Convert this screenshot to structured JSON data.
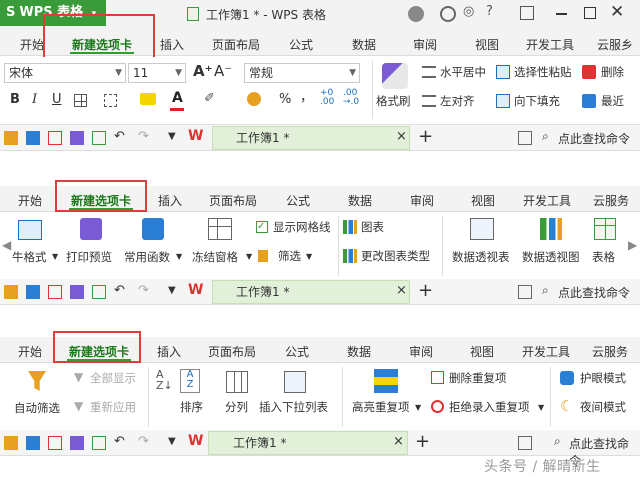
{
  "app": {
    "logo_text": "WPS 表格",
    "doc_title": "工作簿1 * - WPS 表格",
    "accent_color": "#3a9b3a",
    "highlight_color": "#e03c3c"
  },
  "tabs": [
    "开始",
    "新建选项卡",
    "插入",
    "页面布局",
    "公式",
    "数据",
    "审阅",
    "视图",
    "开发工具",
    "云服务"
  ],
  "tabs_clipped": {
    "panel1": "云服乡"
  },
  "panel1": {
    "font_name": "宋体",
    "font_size": "11",
    "number_format": "常规",
    "format_painter": "格式刷",
    "align_center": "水平居中",
    "paste_special": "选择性粘贴",
    "delete": "删除",
    "align_left": "左对齐",
    "fill_down": "向下填充",
    "recent": "最近",
    "bold": "B",
    "italic": "I",
    "underline": "U",
    "text_a": "A",
    "percent": "%",
    "thousands": "，",
    "grow_font": "A⁺",
    "shrink_font": "A⁻"
  },
  "panel2": {
    "table_format": "牛格式",
    "print_preview": "打印预览",
    "common_functions": "常用函数",
    "freeze_panes": "冻结窗格",
    "show_gridlines": "显示网格线",
    "filter": "筛选",
    "chart": "图表",
    "change_chart_type": "更改图表类型",
    "pivot_table": "数据透视表",
    "pivot_chart": "数据透视图",
    "table": "表格"
  },
  "panel3": {
    "auto_filter": "自动筛选",
    "show_all": "全部显示",
    "reapply": "重新应用",
    "sort": "排序",
    "split_columns": "分列",
    "insert_dropdown": "插入下拉列表",
    "highlight_duplicates": "高亮重复项",
    "remove_duplicates": "删除重复项",
    "reject_duplicates": "拒绝录入重复项",
    "eye_protection": "护眼模式",
    "night_mode": "夜间模式"
  },
  "quickbar": {
    "doc_tab": "工作簿1 *",
    "search_placeholder": "点此查找命令",
    "new_tab_symbol": "+",
    "close_symbol": "×"
  },
  "watermark": "头条号 / 解晴新生"
}
